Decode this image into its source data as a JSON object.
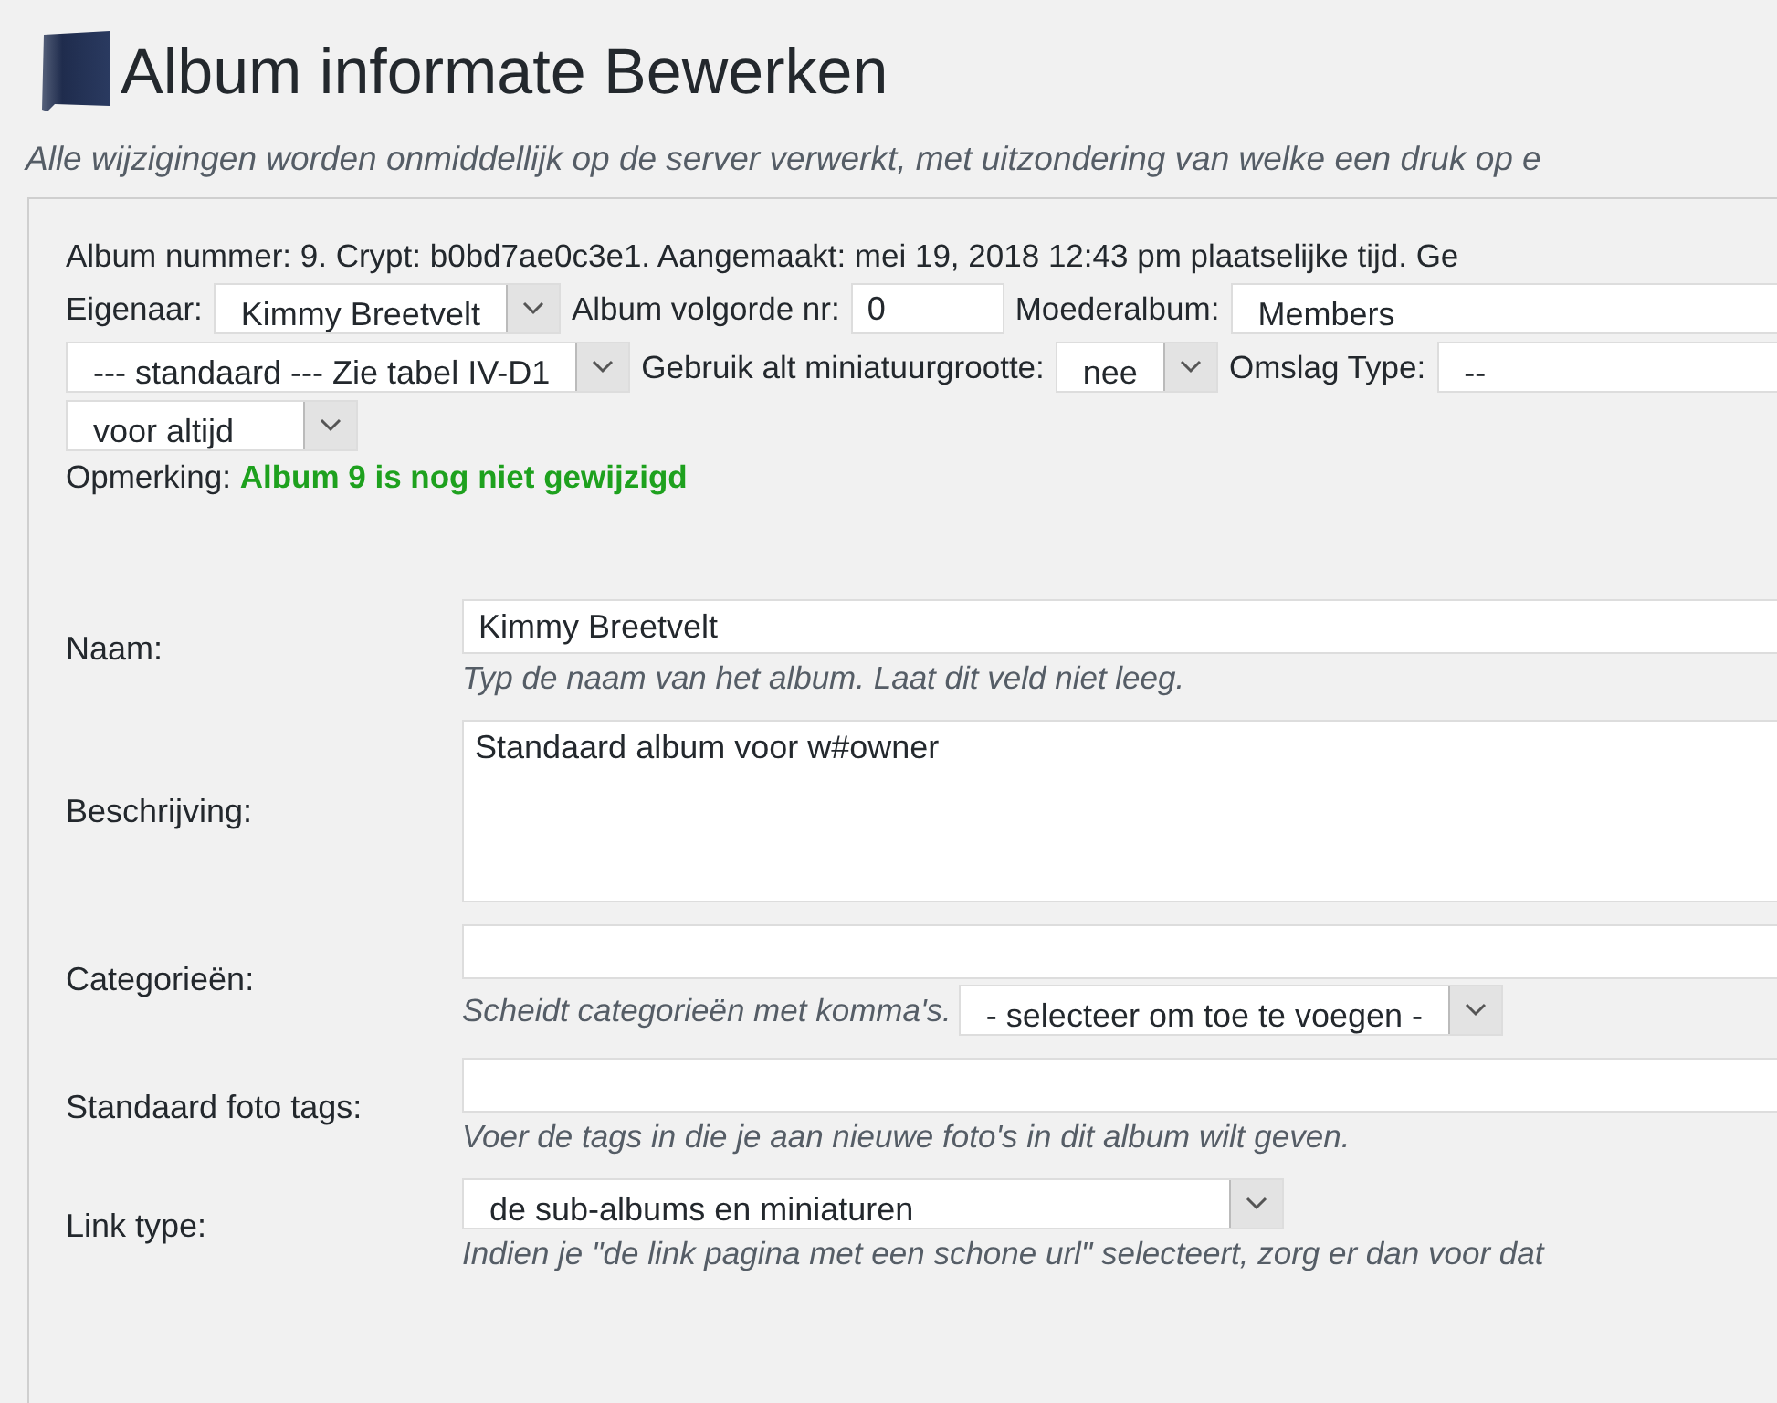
{
  "header": {
    "title": "Album informate Bewerken",
    "subtitle": "Alle wijzigingen worden onmiddellijk op de server verwerkt, met uitzondering van welke een druk op e"
  },
  "info": {
    "line": "Album nummer: 9. Crypt: b0bd7ae0c3e1. Aangemaakt: mei 19, 2018 12:43 pm plaatselijke tijd. Ge"
  },
  "settings_rows": [
    [
      {
        "kind": "label",
        "text": "Eigenaar:"
      },
      {
        "kind": "select",
        "value": "Kimmy Breetvelt"
      },
      {
        "kind": "label",
        "text": "Album volgorde nr:"
      },
      {
        "kind": "input",
        "value": "0"
      },
      {
        "kind": "label",
        "text": "Moederalbum:"
      },
      {
        "kind": "select",
        "value": "Members"
      }
    ],
    [
      {
        "kind": "select",
        "value": "--- standaard --- Zie tabel IV-D1"
      },
      {
        "kind": "label",
        "text": "Gebruik alt miniatuurgrootte:"
      },
      {
        "kind": "select",
        "value": "nee"
      },
      {
        "kind": "label",
        "text": "Omslag Type:"
      },
      {
        "kind": "select",
        "value": "--"
      }
    ],
    [
      {
        "kind": "select",
        "value": "voor altijd"
      }
    ]
  ],
  "remark": {
    "label": "Opmerking:",
    "status": "Album 9 is nog niet gewijzigd"
  },
  "fields": [
    {
      "label": "Naam:",
      "kind": "input",
      "value": "Kimmy Breetvelt",
      "hint": "Typ de naam van het album. Laat dit veld niet leeg."
    },
    {
      "label": "Beschrijving:",
      "kind": "textarea",
      "value": "Standaard album voor w#owner"
    },
    {
      "label": "Categorieën:",
      "kind": "input",
      "hint": "Scheidt categorieën met komma's.",
      "hint_select": "- selecteer om toe te voegen -"
    },
    {
      "label": "Standaard foto tags:",
      "kind": "input",
      "hint": "Voer de tags in die je aan nieuwe foto's in dit album wilt geven."
    },
    {
      "label": "Link type:",
      "kind": "select",
      "value": "de sub-albums en miniaturen",
      "hint": "Indien je \"de link pagina met een schone url\" selecteert, zorg er dan voor dat"
    }
  ]
}
